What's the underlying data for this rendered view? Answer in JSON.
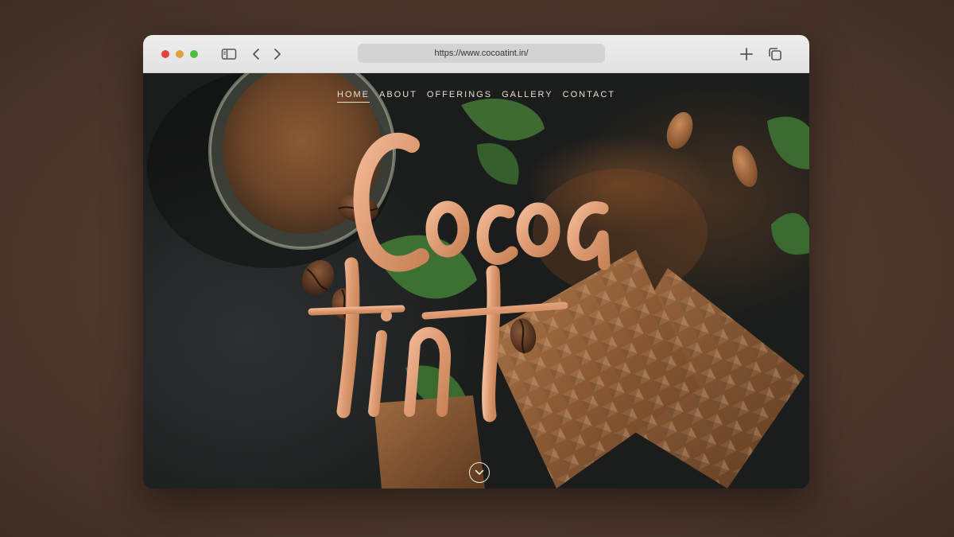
{
  "browser": {
    "url": "https://www.cocoatint.in/"
  },
  "site": {
    "nav": [
      {
        "label": "HOME",
        "active": true
      },
      {
        "label": "ABOUT",
        "active": false
      },
      {
        "label": "OFFERINGS",
        "active": false
      },
      {
        "label": "GALLERY",
        "active": false
      },
      {
        "label": "CONTACT",
        "active": false
      }
    ],
    "logo_text": "Cocoa tint",
    "accent_color": "#e0a07a"
  },
  "icons": {
    "sidebar": "sidebar-toggle-icon",
    "back": "chevron-left-icon",
    "forward": "chevron-right-icon",
    "new_tab": "plus-icon",
    "tabs": "tabs-overview-icon",
    "scroll": "chevron-down-icon"
  }
}
